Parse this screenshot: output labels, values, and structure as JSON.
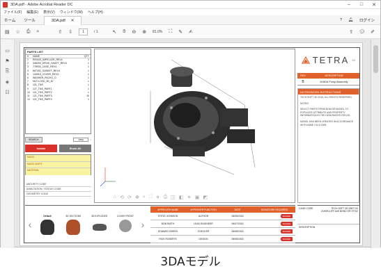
{
  "window": {
    "title": "3DA.pdf - Adobe Acrobat Reader DC"
  },
  "menu": [
    "ファイル(F)",
    "編集(E)",
    "表示(V)",
    "ウィンドウ(W)",
    "ヘルプ(H)"
  ],
  "tabs": {
    "home": "ホーム",
    "tools": "ツール",
    "doc": "3DA.pdf",
    "login": "ログイン"
  },
  "toolbar": {
    "page_current": "1",
    "page_total": "/ 1",
    "zoom": "81.0%"
  },
  "parts_list": {
    "title": "PARTS LIST",
    "headers": {
      "num": "#",
      "name": "NAME",
      "qty": "QTY"
    },
    "rows": [
      {
        "num": "1",
        "name": "R00100_IMPELLER_REV4",
        "qty": "1"
      },
      {
        "num": "2",
        "name": "348290_DRIVE_SHAFT_REV4",
        "qty": "1"
      },
      {
        "num": "3",
        "name": "778934_CASE_REV4",
        "qty": "1"
      },
      {
        "num": "4",
        "name": "667291_GASKET_REV4",
        "qty": "1"
      },
      {
        "num": "5",
        "name": "134015_COVER_REV3",
        "qty": "1"
      },
      {
        "num": "6",
        "name": "WASHER_PACKG_D",
        "qty": "1"
      },
      {
        "num": "7",
        "name": "NUT-LOCK_80_20",
        "qty": "1"
      },
      {
        "num": "8",
        "name": "121_TNS",
        "qty": "1"
      },
      {
        "num": "9",
        "name": "127_TNS_PART1",
        "qty": "1"
      },
      {
        "num": "10",
        "name": "121_TNS_PART2",
        "qty": "1"
      },
      {
        "num": "11",
        "name": "121_TNS_PART3",
        "qty": "10"
      },
      {
        "num": "12",
        "name": "121_TNS_PART4",
        "qty": "1"
      }
    ]
  },
  "search": {
    "label": "SEARCH",
    "mode": "Assy"
  },
  "buttons": {
    "isolate": "Isolate",
    "show_all": "Show All"
  },
  "props": [
    {
      "key": "MASS"
    },
    {
      "key": "MASS UNITS"
    },
    {
      "key": "MATERIAL"
    }
  ],
  "codes": [
    "MATURITY CODE",
    "ANNOTATION / STATUS CODE",
    "GEOMETRY CODE"
  ],
  "brand": {
    "name": "TETRA",
    "sup": "4D"
  },
  "revision": {
    "headers": {
      "rev": "REV",
      "desc": "DESCRIPTION"
    },
    "rows": [
      {
        "rev": "B",
        "desc": "8/4618 Pump Assembly"
      }
    ]
  },
  "notes": {
    "title": "NOTES/WORK INSTRUCTIONS",
    "paragraphs": [
      "TECH SOFT 3D 2016, ALL RIGHTS RESERVED.",
      "NOTES:",
      "SELECT PARTS FROM BOM OR MODEL TO POPULATE ATTRIBUTE AND PROPERTY INFORMATION IN THE DESIGNATED FIELDS.",
      "MODEL HAS BEEN CREATED IN ACCORDANCE WITH ASME Y14.5 2009."
    ]
  },
  "views": [
    {
      "label": "Default",
      "selected": true
    },
    {
      "label": "3D SECTIONS",
      "selected": false
    },
    {
      "label": "3D EXPLODED",
      "selected": false
    },
    {
      "label": "COVER FRONT",
      "selected": false
    }
  ],
  "approvals": {
    "headers": [
      "APPROVER NAME",
      "APPROVER FUNCTION",
      "DATE",
      "SIGNATURE REQUIRED"
    ],
    "rows": [
      {
        "name": "STEVE JOHNSON",
        "func": "AUTHOR",
        "date": "06/05/2016",
        "badge": "SIGNED"
      },
      {
        "name": "BOB SMITH",
        "func": "LEAD ENGINEER",
        "date": "06/07/2016",
        "badge": "SIGNED"
      },
      {
        "name": "EDWARD GREEN",
        "func": "CHECKER",
        "date": "06/08/2016",
        "badge": "SIGNED"
      },
      {
        "name": "RICK ROBERTS",
        "func": "DESIGN",
        "date": "06/08/2016",
        "badge": "SIGNED"
      }
    ]
  },
  "info": {
    "cage_label": "CAGE CODE",
    "cage_value": "TECH SOFT 3D 1567 CH OVERCLIFF AVE BEND OR 97702",
    "desc_label": "DESCRIPTION"
  },
  "caption": "3DAモデル",
  "colors": {
    "accent": "#e0602a",
    "danger": "#d8312a"
  }
}
